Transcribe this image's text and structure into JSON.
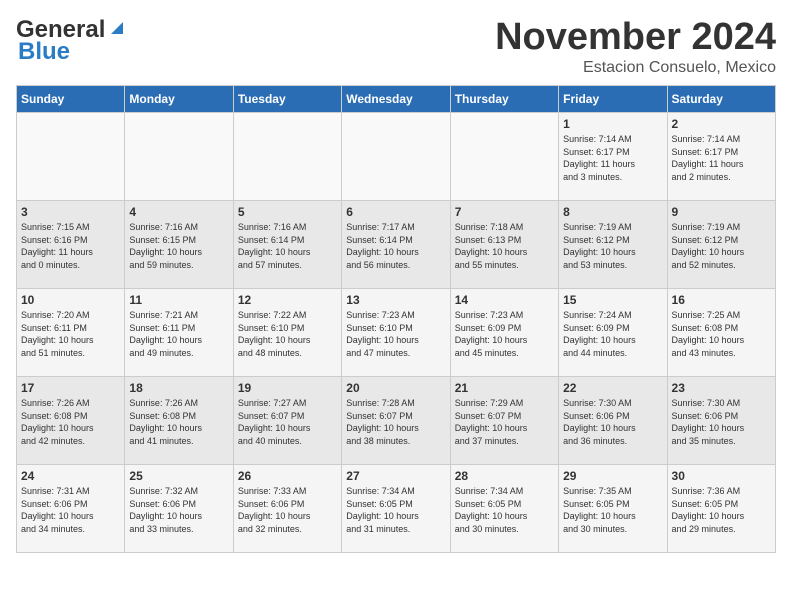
{
  "logo": {
    "part1": "General",
    "part2": "Blue"
  },
  "title": "November 2024",
  "location": "Estacion Consuelo, Mexico",
  "days_of_week": [
    "Sunday",
    "Monday",
    "Tuesday",
    "Wednesday",
    "Thursday",
    "Friday",
    "Saturday"
  ],
  "weeks": [
    [
      {
        "day": "",
        "info": ""
      },
      {
        "day": "",
        "info": ""
      },
      {
        "day": "",
        "info": ""
      },
      {
        "day": "",
        "info": ""
      },
      {
        "day": "",
        "info": ""
      },
      {
        "day": "1",
        "info": "Sunrise: 7:14 AM\nSunset: 6:17 PM\nDaylight: 11 hours\nand 3 minutes."
      },
      {
        "day": "2",
        "info": "Sunrise: 7:14 AM\nSunset: 6:17 PM\nDaylight: 11 hours\nand 2 minutes."
      }
    ],
    [
      {
        "day": "3",
        "info": "Sunrise: 7:15 AM\nSunset: 6:16 PM\nDaylight: 11 hours\nand 0 minutes."
      },
      {
        "day": "4",
        "info": "Sunrise: 7:16 AM\nSunset: 6:15 PM\nDaylight: 10 hours\nand 59 minutes."
      },
      {
        "day": "5",
        "info": "Sunrise: 7:16 AM\nSunset: 6:14 PM\nDaylight: 10 hours\nand 57 minutes."
      },
      {
        "day": "6",
        "info": "Sunrise: 7:17 AM\nSunset: 6:14 PM\nDaylight: 10 hours\nand 56 minutes."
      },
      {
        "day": "7",
        "info": "Sunrise: 7:18 AM\nSunset: 6:13 PM\nDaylight: 10 hours\nand 55 minutes."
      },
      {
        "day": "8",
        "info": "Sunrise: 7:19 AM\nSunset: 6:12 PM\nDaylight: 10 hours\nand 53 minutes."
      },
      {
        "day": "9",
        "info": "Sunrise: 7:19 AM\nSunset: 6:12 PM\nDaylight: 10 hours\nand 52 minutes."
      }
    ],
    [
      {
        "day": "10",
        "info": "Sunrise: 7:20 AM\nSunset: 6:11 PM\nDaylight: 10 hours\nand 51 minutes."
      },
      {
        "day": "11",
        "info": "Sunrise: 7:21 AM\nSunset: 6:11 PM\nDaylight: 10 hours\nand 49 minutes."
      },
      {
        "day": "12",
        "info": "Sunrise: 7:22 AM\nSunset: 6:10 PM\nDaylight: 10 hours\nand 48 minutes."
      },
      {
        "day": "13",
        "info": "Sunrise: 7:23 AM\nSunset: 6:10 PM\nDaylight: 10 hours\nand 47 minutes."
      },
      {
        "day": "14",
        "info": "Sunrise: 7:23 AM\nSunset: 6:09 PM\nDaylight: 10 hours\nand 45 minutes."
      },
      {
        "day": "15",
        "info": "Sunrise: 7:24 AM\nSunset: 6:09 PM\nDaylight: 10 hours\nand 44 minutes."
      },
      {
        "day": "16",
        "info": "Sunrise: 7:25 AM\nSunset: 6:08 PM\nDaylight: 10 hours\nand 43 minutes."
      }
    ],
    [
      {
        "day": "17",
        "info": "Sunrise: 7:26 AM\nSunset: 6:08 PM\nDaylight: 10 hours\nand 42 minutes."
      },
      {
        "day": "18",
        "info": "Sunrise: 7:26 AM\nSunset: 6:08 PM\nDaylight: 10 hours\nand 41 minutes."
      },
      {
        "day": "19",
        "info": "Sunrise: 7:27 AM\nSunset: 6:07 PM\nDaylight: 10 hours\nand 40 minutes."
      },
      {
        "day": "20",
        "info": "Sunrise: 7:28 AM\nSunset: 6:07 PM\nDaylight: 10 hours\nand 38 minutes."
      },
      {
        "day": "21",
        "info": "Sunrise: 7:29 AM\nSunset: 6:07 PM\nDaylight: 10 hours\nand 37 minutes."
      },
      {
        "day": "22",
        "info": "Sunrise: 7:30 AM\nSunset: 6:06 PM\nDaylight: 10 hours\nand 36 minutes."
      },
      {
        "day": "23",
        "info": "Sunrise: 7:30 AM\nSunset: 6:06 PM\nDaylight: 10 hours\nand 35 minutes."
      }
    ],
    [
      {
        "day": "24",
        "info": "Sunrise: 7:31 AM\nSunset: 6:06 PM\nDaylight: 10 hours\nand 34 minutes."
      },
      {
        "day": "25",
        "info": "Sunrise: 7:32 AM\nSunset: 6:06 PM\nDaylight: 10 hours\nand 33 minutes."
      },
      {
        "day": "26",
        "info": "Sunrise: 7:33 AM\nSunset: 6:06 PM\nDaylight: 10 hours\nand 32 minutes."
      },
      {
        "day": "27",
        "info": "Sunrise: 7:34 AM\nSunset: 6:05 PM\nDaylight: 10 hours\nand 31 minutes."
      },
      {
        "day": "28",
        "info": "Sunrise: 7:34 AM\nSunset: 6:05 PM\nDaylight: 10 hours\nand 30 minutes."
      },
      {
        "day": "29",
        "info": "Sunrise: 7:35 AM\nSunset: 6:05 PM\nDaylight: 10 hours\nand 30 minutes."
      },
      {
        "day": "30",
        "info": "Sunrise: 7:36 AM\nSunset: 6:05 PM\nDaylight: 10 hours\nand 29 minutes."
      }
    ]
  ]
}
